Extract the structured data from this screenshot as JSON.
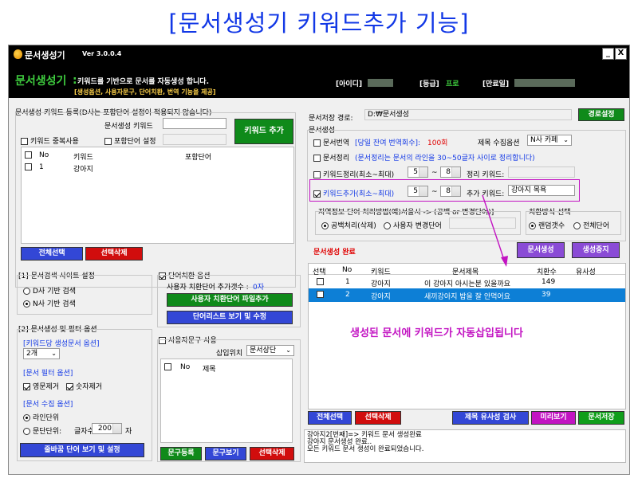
{
  "heading": "[문서생성기 키워드추가 기능]",
  "window": {
    "title": "문서생성기",
    "version": "Ver 3.0.0.4",
    "min": "_",
    "close": "X"
  },
  "info": {
    "app": "문서생성기",
    "desc": "키워드를 기반으로 문서를 자동생성 합니다.",
    "sub": "[생성옵션, 사용자문구, 단어치환, 번역 기능을 제공]",
    "id_label": "[아이디]",
    "grade_label": "[등급]",
    "grade_value": "프로",
    "expire_label": "[만료일]"
  },
  "left": {
    "kw_group": "문서생성 키워드 등록(D사는 포함단어 설정이 적용되지 않습니다)",
    "kw_label": "문서생성 키워드",
    "kw_add": "키워드 추가",
    "dup_allow": "키워드 중복사용",
    "include_set": "포함단어 설정",
    "table_headers": {
      "no": "No",
      "keyword": "키워드",
      "include": "포함단어"
    },
    "rows": [
      {
        "no": "1",
        "keyword": "강아지"
      }
    ],
    "select_all": "전체선택",
    "delete_sel": "선택삭제",
    "site_group": "[1] 문서검색 사이트 설정",
    "site_d": "D사 기반 검색",
    "site_n": "N사 기반 검색",
    "filter_group": "[2] 문서생성 및 필터 옵션",
    "per_kw": "[키워드당 생성문서 옵션]",
    "per_kw_value": "2개",
    "filter_opt": "[문서 필터 옵션]",
    "eng_remove": "영문제거",
    "num_remove": "숫자제거",
    "collect_opt": "[문서 수집 옵션]",
    "line_unit": "라인단위",
    "para_unit": "문단단위:",
    "char_count": "글자수",
    "char_value": "200",
    "char_suffix": "자",
    "newline_btn": "줄바꿈 단어 보기 및 설정"
  },
  "middle": {
    "replace_opt": "단어치환 옵션",
    "replace_count_label": "사용자 치환단어 추가갯수 :",
    "replace_count": "0자",
    "replace_file": "사용자 치환단어 파일추가",
    "word_list": "단어리스트 보기 및 수정",
    "user_phrase": "사용자문구 사용",
    "insert_pos": "삽입위치",
    "insert_value": "문서상단",
    "ph_no": "No",
    "ph_title": "제목",
    "ph_register": "문구등록",
    "ph_view": "문구보기",
    "ph_delete": "선택삭제"
  },
  "right": {
    "save_path_label": "문서저장 경로:",
    "save_path": "D:₩문서생성",
    "path_btn": "경로설정",
    "gen_group": "문서생성",
    "translate": "문서번역",
    "translate_info": "[당일 잔여 번역회수]:",
    "translate_count": "100회",
    "title_collect": "제목 수집옵션",
    "title_value": "N사 카페",
    "doc_clean": "문서정리",
    "doc_clean_info": "(문서정리는 문서의 라인을 30~50글자 사이로 정리합니다)",
    "kw_clean": "키워드정리(최소~최대)",
    "kw_clean_min": "5",
    "kw_clean_max": "8",
    "tilde": "~",
    "clean_kw_label": "정리 키워드:",
    "kw_add": "키워드추가(최소~최대)",
    "kw_add_min": "5",
    "kw_add_max": "8",
    "add_kw_label": "추가 키워드:",
    "add_kw_value": "강아지 목욕",
    "region_group": "지역정보 단어 처리방법(예)서울시 -> (공백 or 변경단어)]",
    "region_blank": "공백처리(삭제)",
    "region_user": "사용자 변경단어",
    "replace_group": "치환방식 선택",
    "random_count": "랜덤갯수",
    "all_words": "전체단어",
    "status": "문서생성 완료",
    "gen_btn": "문서생성",
    "stop_btn": "생성중지",
    "table_headers": {
      "sel": "선택",
      "no": "No",
      "keyword": "키워드",
      "title": "문서제목",
      "count": "치환수",
      "sim": "유사성"
    },
    "rows": [
      {
        "no": "1",
        "keyword": "강아지",
        "title": "이 강아지 아시는분 있을까요",
        "count": "149",
        "sim": ""
      },
      {
        "no": "2",
        "keyword": "강아지",
        "title": "새끼강아지 밥을 잘 안먹어요",
        "count": "39",
        "sim": ""
      }
    ],
    "annotation": "생성된 문서에 키워드가 자동삽입됩니다",
    "select_all": "전체선택",
    "delete_sel": "선택삭제",
    "sim_check": "제목 유사성 검사",
    "preview": "미리보기",
    "save_doc": "문서저장",
    "log": [
      "강아지2[번째]=> 키워드 문서 생성완료",
      "강아지 문서생성 완료..",
      "모든 키워드 문서 생성이 완료되었습니다."
    ]
  },
  "colors": {
    "accent_green": "#0f8a1a",
    "accent_blue": "#3347d6",
    "accent_red": "#d10d0d",
    "accent_purple": "#8a4bd6",
    "selected_row": "#0d7fd6",
    "highlight_box": "#c213c2"
  }
}
